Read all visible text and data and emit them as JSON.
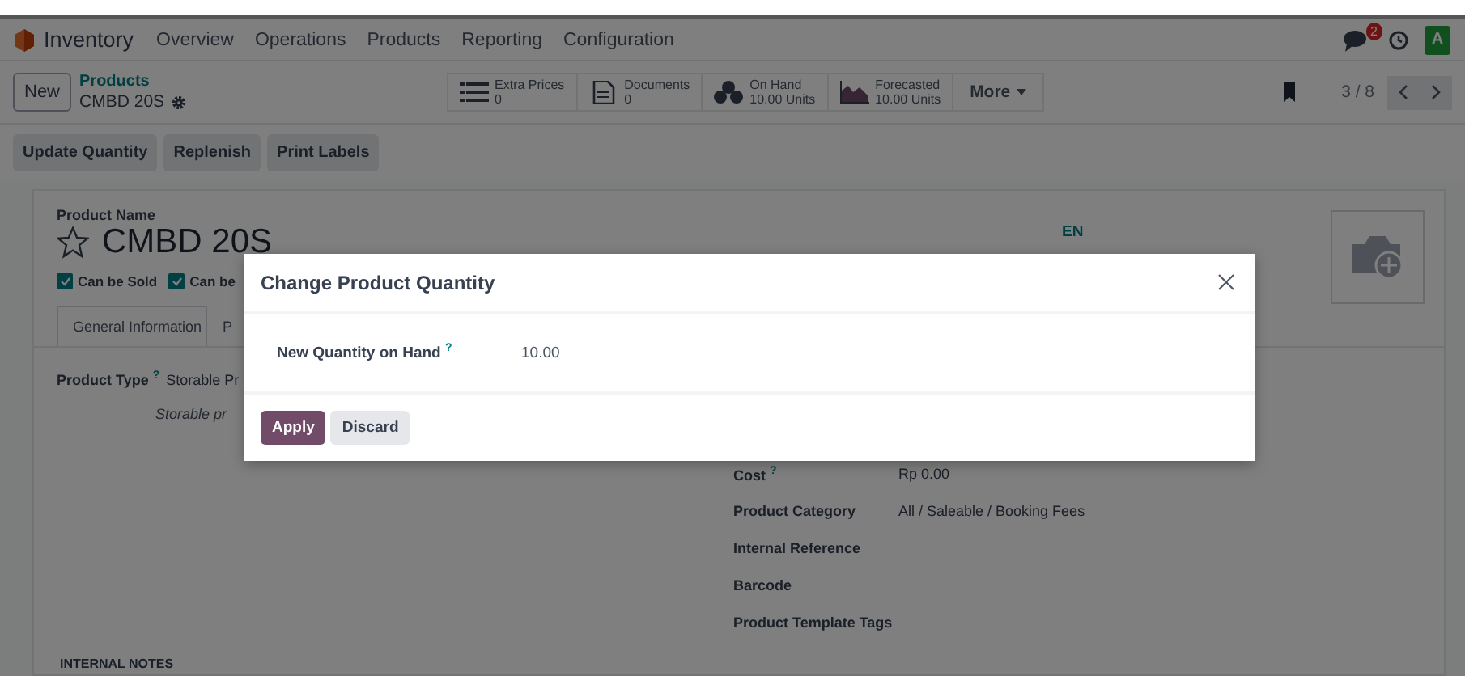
{
  "navbar": {
    "app": "Inventory",
    "menu": [
      "Overview",
      "Operations",
      "Products",
      "Reporting",
      "Configuration"
    ],
    "notification_count": "2",
    "avatar": "A"
  },
  "control_panel": {
    "new_button": "New",
    "breadcrumb": "Products",
    "record": "CMBD 20S",
    "smart_buttons": [
      {
        "kind": "list",
        "label": "Extra Prices",
        "value": "0"
      },
      {
        "kind": "document",
        "label": "Documents",
        "value": "0"
      },
      {
        "kind": "cubes",
        "label": "On Hand",
        "value": "10.00 Units"
      },
      {
        "kind": "chart",
        "label": "Forecasted",
        "value": "10.00 Units"
      }
    ],
    "more": "More",
    "pager": "3 / 8"
  },
  "actions": [
    "Update Quantity",
    "Replenish",
    "Print Labels"
  ],
  "form": {
    "name_label": "Product Name",
    "name": "CMBD 20S",
    "favorite": false,
    "language": "EN",
    "options": [
      {
        "label": "Can be Sold",
        "checked": true
      },
      {
        "label": "Can be",
        "checked": true
      }
    ],
    "tabs": [
      {
        "label": "General Information",
        "selected": true
      },
      {
        "label": "P",
        "selected": false
      }
    ],
    "left_fields": [
      {
        "label": "Product Type",
        "help": "?",
        "value": "Storable Pr",
        "note": "Storable pr"
      }
    ],
    "right_fields": [
      {
        "label": "Cost",
        "help": "?",
        "value": "Rp 0.00"
      },
      {
        "label": "Product Category",
        "value": "All / Saleable / Booking Fees"
      },
      {
        "label": "Internal Reference"
      },
      {
        "label": "Barcode"
      },
      {
        "label": "Product Template Tags"
      }
    ],
    "section": "INTERNAL NOTES"
  },
  "dialog": {
    "title": "Change Product Quantity",
    "field": {
      "label": "New Quantity on Hand",
      "help": "?",
      "value": "10.00"
    },
    "buttons": [
      {
        "label": "Apply",
        "kind": "primary"
      },
      {
        "label": "Discard",
        "kind": "secondary"
      }
    ]
  }
}
